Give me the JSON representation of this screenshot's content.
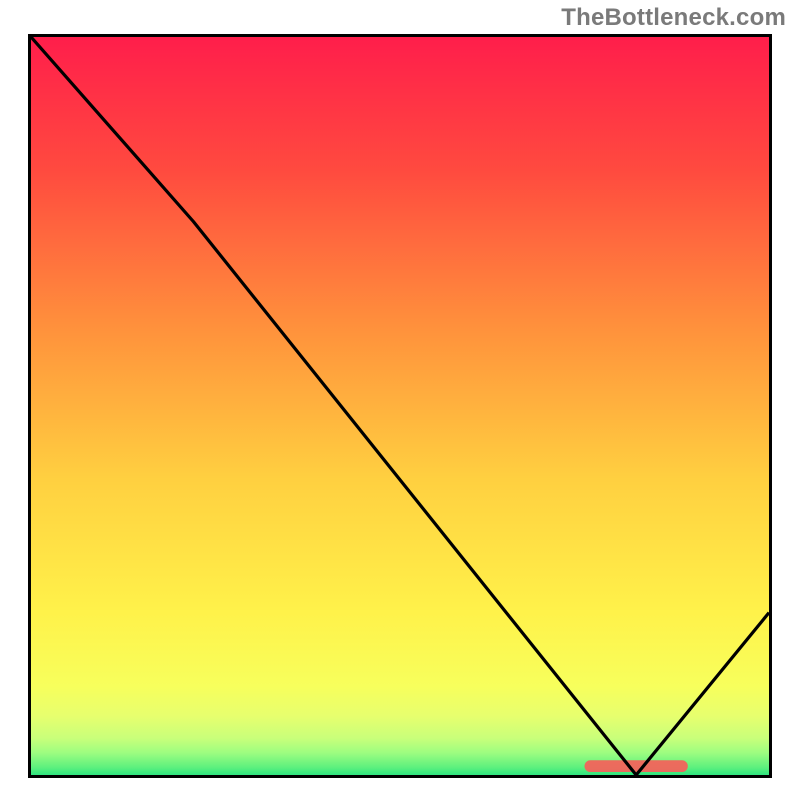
{
  "watermark": "TheBottleneck.com",
  "chart_data": {
    "type": "line",
    "title": "",
    "xlabel": "",
    "ylabel": "",
    "xlim": [
      0,
      100
    ],
    "ylim": [
      0,
      100
    ],
    "x": [
      0,
      22,
      82,
      100
    ],
    "values": [
      100,
      75,
      0,
      22
    ],
    "optimum_band": {
      "x_start": 75,
      "x_end": 89,
      "y_pct": 1.2
    },
    "background_gradient": {
      "stops": [
        {
          "offset": 0,
          "color": "#ff1e4b"
        },
        {
          "offset": 18,
          "color": "#ff4a3f"
        },
        {
          "offset": 40,
          "color": "#ff933c"
        },
        {
          "offset": 60,
          "color": "#ffd040"
        },
        {
          "offset": 78,
          "color": "#fff24a"
        },
        {
          "offset": 88,
          "color": "#f7ff5c"
        },
        {
          "offset": 92,
          "color": "#e7ff6e"
        },
        {
          "offset": 95,
          "color": "#c9ff7a"
        },
        {
          "offset": 97,
          "color": "#9dfd80"
        },
        {
          "offset": 99,
          "color": "#5cf07e"
        },
        {
          "offset": 100,
          "color": "#2fe57f"
        }
      ]
    }
  }
}
